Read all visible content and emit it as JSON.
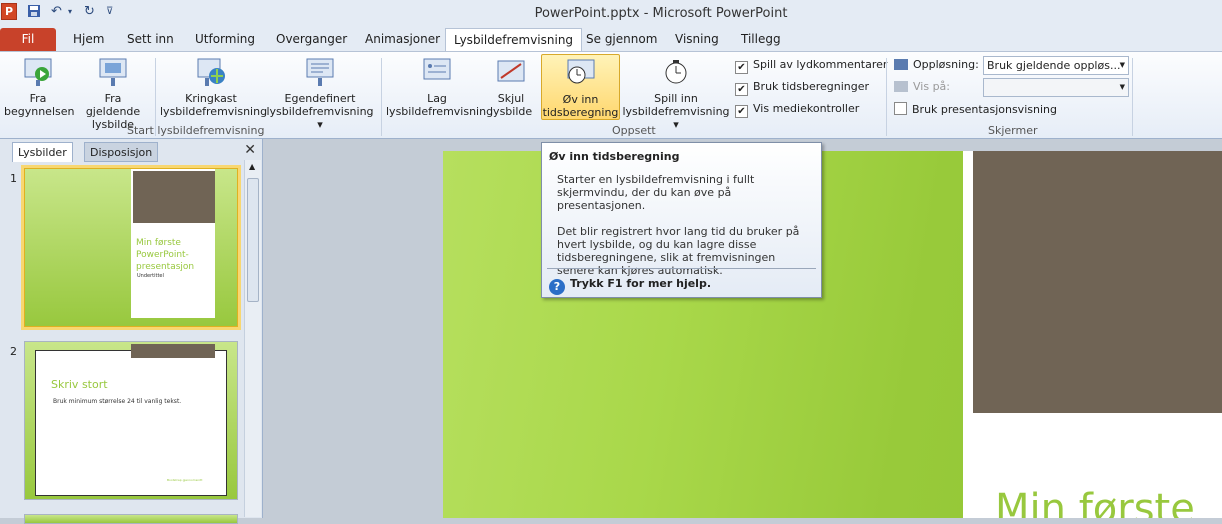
{
  "window": {
    "title": "PowerPoint.pptx  -  Microsoft PowerPoint",
    "app_icon_letter": "P"
  },
  "tabs": {
    "file": "Fil",
    "items": [
      "Hjem",
      "Sett inn",
      "Utforming",
      "Overganger",
      "Animasjoner",
      "Lysbildefremvisning",
      "Se gjennom",
      "Visning",
      "Tillegg"
    ],
    "active": "Lysbildefremvisning"
  },
  "ribbon": {
    "start_group": {
      "label": "Start lysbildefremvisning",
      "from_beginning": [
        "Fra",
        "begynnelsen"
      ],
      "from_current": [
        "Fra gjeldende",
        "lysbilde"
      ],
      "broadcast": [
        "Kringkast",
        "lysbildefremvisning"
      ],
      "custom": [
        "Egendefinert",
        "lysbildefremvisning ▾"
      ]
    },
    "setup_group": {
      "label": "Oppsett",
      "create": [
        "Lag",
        "lysbildefremvisning"
      ],
      "hide": [
        "Skjul",
        "lysbilde"
      ],
      "rehearse": [
        "Øv inn",
        "tidsberegning"
      ],
      "record": [
        "Spill inn",
        "lysbildefremvisning ▾"
      ],
      "checks": [
        {
          "label": "Spill av lydkommentarer",
          "checked": true
        },
        {
          "label": "Bruk tidsberegninger",
          "checked": true
        },
        {
          "label": "Vis mediekontroller",
          "checked": true
        }
      ]
    },
    "screens_group": {
      "label": "Skjermer",
      "resolution_label": "Oppløsning:",
      "resolution_value": "Bruk gjeldende oppløs...",
      "show_on_label": "Vis på:",
      "show_on_value": "",
      "presenter_view": {
        "label": "Bruk presentasjonsvisning",
        "checked": false
      }
    }
  },
  "left_panel": {
    "tabs": [
      "Lysbilder",
      "Disposisjon"
    ],
    "active_tab": "Lysbilder",
    "close": "✕",
    "slides": [
      {
        "number": "1",
        "title": "Min første PowerPoint-presentasjon",
        "subtitle": "Undertittel"
      },
      {
        "number": "2",
        "title": "Skriv stort",
        "bullet": "Bruk minimum størrelse 24 til vanlig tekst.",
        "footer": "Bootstrap gjennomsnitt"
      }
    ]
  },
  "main_slide": {
    "title_fragment": "Min første"
  },
  "tooltip": {
    "title": "Øv inn tidsberegning",
    "para1": "Starter en lysbildefremvisning i fullt skjermvindu, der du kan øve på presentasjonen.",
    "para2": "Det blir registrert hvor lang tid du bruker på hvert lysbilde, og du kan lagre disse tidsberegningene, slik at fremvisningen senere kan kjøres automatisk.",
    "help": "Trykk F1 for mer hjelp."
  },
  "colors": {
    "accent_green": "#98c83e",
    "brown": "#706455",
    "file_tab": "#c8422a",
    "highlight": "#ffd76e"
  }
}
